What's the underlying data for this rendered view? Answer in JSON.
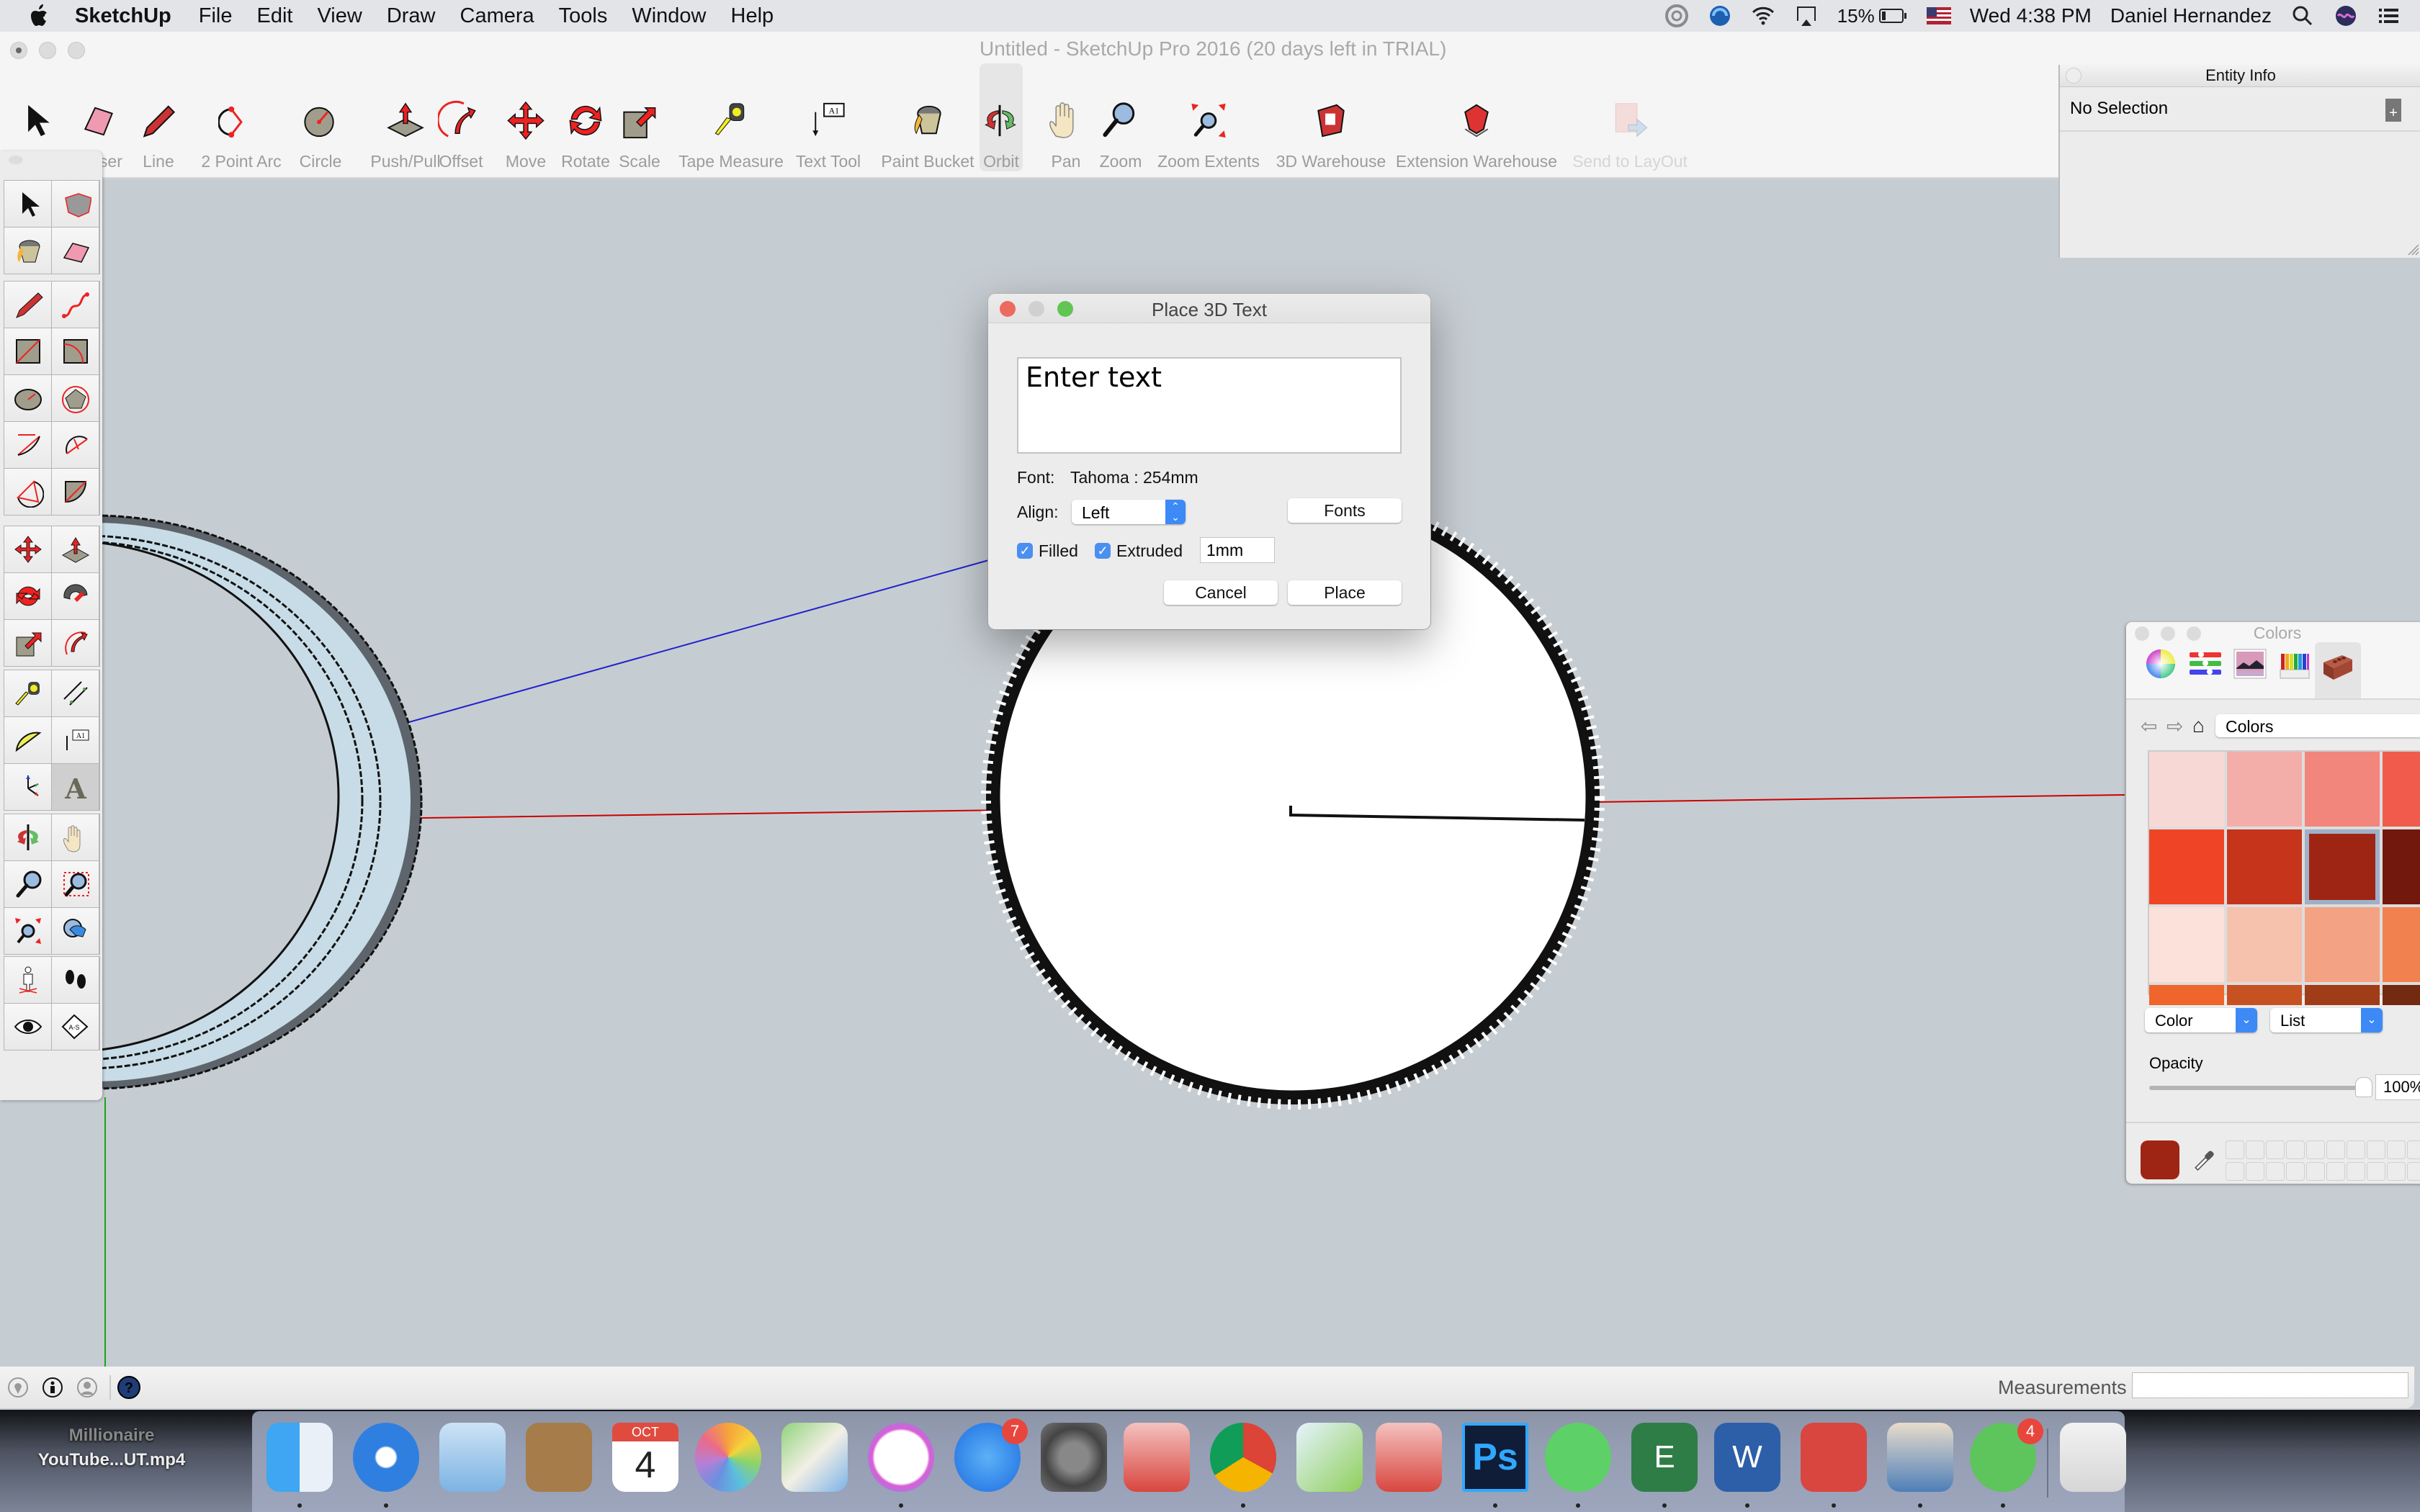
{
  "menubar": {
    "app_name": "SketchUp",
    "items": [
      "File",
      "Edit",
      "View",
      "Draw",
      "Camera",
      "Tools",
      "Window",
      "Help"
    ],
    "status": {
      "battery": "15%",
      "clock": "Wed 4:38 PM",
      "user": "Daniel Hernandez"
    }
  },
  "window": {
    "title": "Untitled - SketchUp Pro 2016 (20 days left in TRIAL)"
  },
  "toolbar": {
    "tools": [
      {
        "label": "Select",
        "icon": "select-arrow-icon"
      },
      {
        "label": "Eraser",
        "icon": "eraser-icon"
      },
      {
        "label": "Line",
        "icon": "pencil-icon"
      },
      {
        "label": "2 Point Arc",
        "icon": "arc-icon"
      },
      {
        "label": "Circle",
        "icon": "circle-icon"
      },
      {
        "label": "Push/Pull",
        "icon": "push-pull-icon"
      },
      {
        "label": "Offset",
        "icon": "offset-icon"
      },
      {
        "label": "Move",
        "icon": "move-icon"
      },
      {
        "label": "Rotate",
        "icon": "rotate-icon"
      },
      {
        "label": "Scale",
        "icon": "scale-icon"
      },
      {
        "label": "Tape Measure",
        "icon": "tape-measure-icon"
      },
      {
        "label": "Text Tool",
        "icon": "text-tool-icon"
      },
      {
        "label": "Paint Bucket",
        "icon": "paint-bucket-icon"
      },
      {
        "label": "Orbit",
        "icon": "orbit-icon",
        "active": true
      },
      {
        "label": "Pan",
        "icon": "pan-hand-icon"
      },
      {
        "label": "Zoom",
        "icon": "zoom-icon"
      },
      {
        "label": "Zoom Extents",
        "icon": "zoom-extents-icon"
      },
      {
        "label": "3D Warehouse",
        "icon": "3d-warehouse-icon"
      },
      {
        "label": "Extension Warehouse",
        "icon": "extension-warehouse-icon"
      },
      {
        "label": "Send to LayOut",
        "icon": "send-to-layout-icon",
        "disabled": true
      }
    ]
  },
  "entity_info": {
    "title": "Entity Info",
    "selection": "No Selection"
  },
  "dialog": {
    "title": "Place 3D Text",
    "text_value": "Enter text",
    "font_label": "Font:",
    "font_value": "Tahoma : 254mm",
    "align_label": "Align:",
    "align_value": "Left",
    "fonts_button": "Fonts",
    "filled_label": "Filled",
    "filled_checked": true,
    "extruded_label": "Extruded",
    "extruded_checked": true,
    "extrude_value": "1mm",
    "cancel_button": "Cancel",
    "place_button": "Place"
  },
  "colors_panel": {
    "title": "Colors",
    "tabs": [
      "color-wheel",
      "color-sliders",
      "color-palettes",
      "image-palettes",
      "crayons",
      "sketchup-materials"
    ],
    "active_tab": "sketchup-materials",
    "collection": "Colors",
    "swatches": [
      [
        "#f8d8d5",
        "#f3aeaa",
        "#f2857c",
        "#f05b4c"
      ],
      [
        "#ef4526",
        "#c6341c",
        "#9e2514",
        "#72180c"
      ],
      [
        "#fbe1da",
        "#f6c1ad",
        "#f3a283",
        "#f18250"
      ],
      [
        "#ef652b",
        "#c75221",
        "#9f3d18",
        "#722a10"
      ]
    ],
    "selected_swatch": [
      1,
      2
    ],
    "mode_select": "Color",
    "view_select": "List",
    "opacity_label": "Opacity",
    "opacity_value": "100%",
    "opacity_fraction": 1.0,
    "current_color": "#9e2514"
  },
  "statusbar": {
    "measurements_label": "Measurements",
    "measurements_value": ""
  },
  "desktop": {
    "file_line1": "Millionaire",
    "file_line2": "YouTube...UT.mp4"
  },
  "dock": {
    "apps": [
      {
        "name": "Finder",
        "running": true
      },
      {
        "name": "Safari",
        "running": true
      },
      {
        "name": "Mail",
        "running": false
      },
      {
        "name": "Contacts",
        "running": false
      },
      {
        "name": "Calendar",
        "running": false,
        "month": "OCT",
        "day": "4"
      },
      {
        "name": "Photos",
        "running": false
      },
      {
        "name": "Maps",
        "running": false
      },
      {
        "name": "iTunes",
        "running": true
      },
      {
        "name": "App Store",
        "running": false,
        "badge": "7"
      },
      {
        "name": "System Preferences",
        "running": false
      },
      {
        "name": "AutoCAD",
        "running": false
      },
      {
        "name": "Chrome",
        "running": true
      },
      {
        "name": "Mind Map",
        "running": false
      },
      {
        "name": "AutoCAD 2",
        "running": false
      },
      {
        "name": "Photoshop",
        "running": true
      },
      {
        "name": "Spotify",
        "running": true
      },
      {
        "name": "Excel",
        "running": true
      },
      {
        "name": "Word",
        "running": true
      },
      {
        "name": "SketchUp",
        "running": true
      },
      {
        "name": "Preview",
        "running": true
      },
      {
        "name": "WhatsApp",
        "running": true,
        "badge": "4"
      },
      {
        "name": "Trash",
        "running": false
      }
    ]
  }
}
